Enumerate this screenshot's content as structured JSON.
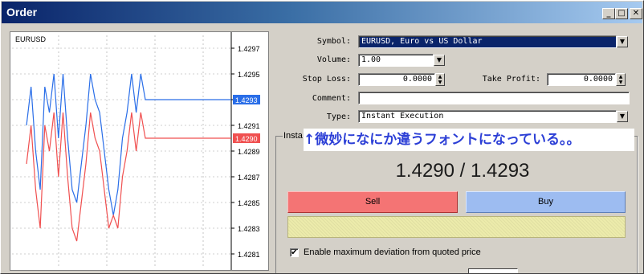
{
  "window": {
    "title": "Order",
    "controls": {
      "minimize": "_",
      "maximize": "□",
      "close": "✕"
    }
  },
  "chart": {
    "symbol_label": "EURUSD",
    "y_ticks": [
      "1.4297",
      "1.4295",
      "1.4293",
      "1.4291",
      "1.4289",
      "1.4287",
      "1.4285",
      "1.4283",
      "1.4281"
    ],
    "ask_tag": "1.4293",
    "bid_tag": "1.4290",
    "colors": {
      "ask": "#2a6ee8",
      "bid": "#f05050",
      "grid": "#a0a0a0"
    }
  },
  "chart_data": {
    "type": "line",
    "title": "EURUSD",
    "ylim": [
      1.428,
      1.4298
    ],
    "grid": true,
    "series": [
      {
        "name": "",
        "values": [
          1.4291,
          1.4294,
          1.4289,
          1.4286,
          1.4294,
          1.4292,
          1.4295,
          1.429,
          1.4295,
          1.429,
          1.4286,
          1.4285,
          1.4288,
          1.4291,
          1.4295,
          1.4293,
          1.4292,
          1.4289,
          1.4286,
          1.4284,
          1.4286,
          1.429,
          1.4292,
          1.4295,
          1.4292,
          1.4295,
          1.4293,
          1.4293,
          1.4293,
          1.4293
        ]
      },
      {
        "name": "",
        "values": [
          1.4288,
          1.4291,
          1.4286,
          1.4283,
          1.4291,
          1.4289,
          1.4292,
          1.4287,
          1.4292,
          1.4287,
          1.4283,
          1.4282,
          1.4285,
          1.4288,
          1.4292,
          1.429,
          1.4289,
          1.4286,
          1.4283,
          1.4284,
          1.4283,
          1.4287,
          1.4289,
          1.4292,
          1.4289,
          1.4292,
          1.429,
          1.429,
          1.429,
          1.429
        ]
      }
    ]
  },
  "form": {
    "symbol_label": "Symbol:",
    "symbol_value": "EURUSD, Euro vs US Dollar",
    "volume_label": "Volume:",
    "volume_value": "1.00",
    "stop_loss_label": "Stop Loss:",
    "stop_loss_value": "0.0000",
    "take_profit_label": "Take Profit:",
    "take_profit_value": "0.0000",
    "comment_label": "Comment:",
    "comment_value": "",
    "type_label": "Type:",
    "type_value": "Instant Execution"
  },
  "execution": {
    "group_title": "Insta",
    "annotation": "↑微妙になにか違うフォントになっている。。",
    "price_display": "1.4290 / 1.4293",
    "sell_label": "Sell",
    "buy_label": "Buy",
    "deviation_checked": "✔",
    "deviation_label": "Enable maximum deviation from quoted price"
  }
}
